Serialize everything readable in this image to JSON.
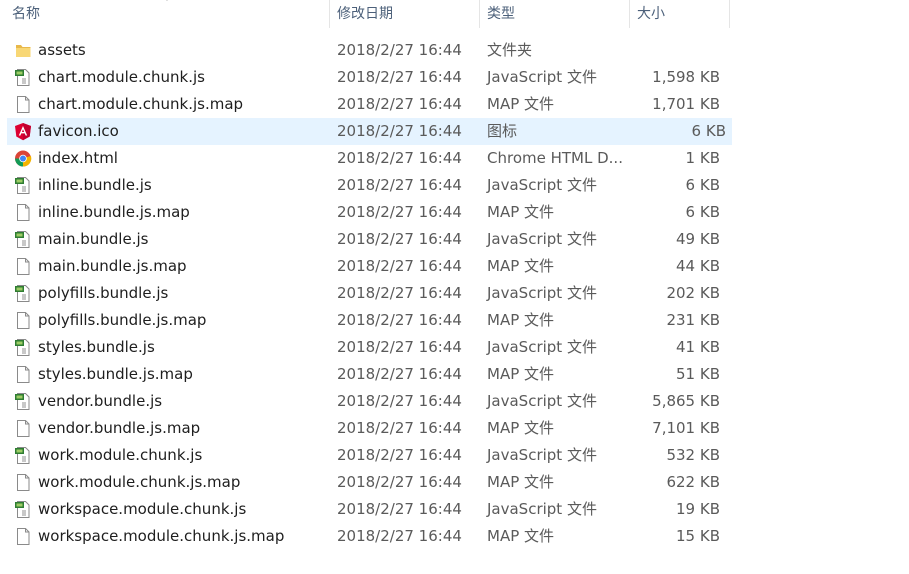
{
  "header": {
    "name": "名称",
    "date": "修改日期",
    "type": "类型",
    "size": "大小"
  },
  "files": [
    {
      "name": "assets",
      "date": "2018/2/27 16:44",
      "type": "文件夹",
      "size": "",
      "icon": "folder-icon"
    },
    {
      "name": "chart.module.chunk.js",
      "date": "2018/2/27 16:44",
      "type": "JavaScript 文件",
      "size": "1,598 KB",
      "icon": "js-file-icon"
    },
    {
      "name": "chart.module.chunk.js.map",
      "date": "2018/2/27 16:44",
      "type": "MAP 文件",
      "size": "1,701 KB",
      "icon": "file-icon"
    },
    {
      "name": "favicon.ico",
      "date": "2018/2/27 16:44",
      "type": "图标",
      "size": "6 KB",
      "icon": "angular-icon",
      "selected": true
    },
    {
      "name": "index.html",
      "date": "2018/2/27 16:44",
      "type": "Chrome HTML D...",
      "size": "1 KB",
      "icon": "chrome-icon"
    },
    {
      "name": "inline.bundle.js",
      "date": "2018/2/27 16:44",
      "type": "JavaScript 文件",
      "size": "6 KB",
      "icon": "js-file-icon"
    },
    {
      "name": "inline.bundle.js.map",
      "date": "2018/2/27 16:44",
      "type": "MAP 文件",
      "size": "6 KB",
      "icon": "file-icon"
    },
    {
      "name": "main.bundle.js",
      "date": "2018/2/27 16:44",
      "type": "JavaScript 文件",
      "size": "49 KB",
      "icon": "js-file-icon"
    },
    {
      "name": "main.bundle.js.map",
      "date": "2018/2/27 16:44",
      "type": "MAP 文件",
      "size": "44 KB",
      "icon": "file-icon"
    },
    {
      "name": "polyfills.bundle.js",
      "date": "2018/2/27 16:44",
      "type": "JavaScript 文件",
      "size": "202 KB",
      "icon": "js-file-icon"
    },
    {
      "name": "polyfills.bundle.js.map",
      "date": "2018/2/27 16:44",
      "type": "MAP 文件",
      "size": "231 KB",
      "icon": "file-icon"
    },
    {
      "name": "styles.bundle.js",
      "date": "2018/2/27 16:44",
      "type": "JavaScript 文件",
      "size": "41 KB",
      "icon": "js-file-icon"
    },
    {
      "name": "styles.bundle.js.map",
      "date": "2018/2/27 16:44",
      "type": "MAP 文件",
      "size": "51 KB",
      "icon": "file-icon"
    },
    {
      "name": "vendor.bundle.js",
      "date": "2018/2/27 16:44",
      "type": "JavaScript 文件",
      "size": "5,865 KB",
      "icon": "js-file-icon"
    },
    {
      "name": "vendor.bundle.js.map",
      "date": "2018/2/27 16:44",
      "type": "MAP 文件",
      "size": "7,101 KB",
      "icon": "file-icon"
    },
    {
      "name": "work.module.chunk.js",
      "date": "2018/2/27 16:44",
      "type": "JavaScript 文件",
      "size": "532 KB",
      "icon": "js-file-icon"
    },
    {
      "name": "work.module.chunk.js.map",
      "date": "2018/2/27 16:44",
      "type": "MAP 文件",
      "size": "622 KB",
      "icon": "file-icon"
    },
    {
      "name": "workspace.module.chunk.js",
      "date": "2018/2/27 16:44",
      "type": "JavaScript 文件",
      "size": "19 KB",
      "icon": "js-file-icon"
    },
    {
      "name": "workspace.module.chunk.js.map",
      "date": "2018/2/27 16:44",
      "type": "MAP 文件",
      "size": "15 KB",
      "icon": "file-icon"
    }
  ],
  "colors": {
    "selection": "#e5f3ff",
    "header_text": "#4c607a",
    "folder": "#f8d775",
    "js_green": "#2e7d32",
    "angular_red": "#dd0031"
  }
}
